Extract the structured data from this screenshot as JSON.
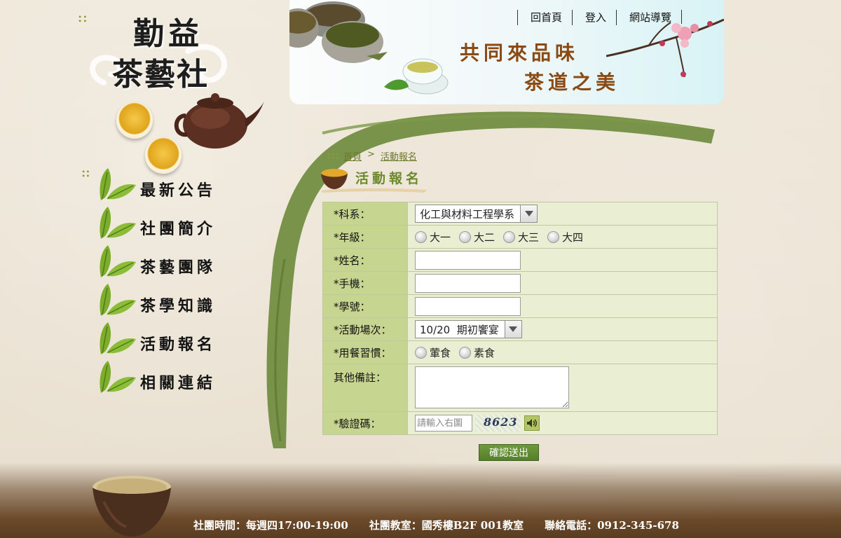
{
  "logo": {
    "line1": "勤益",
    "line2": "茶藝社"
  },
  "top_nav": [
    "回首頁",
    "登入",
    "網站導覽"
  ],
  "banner": {
    "slogan_line1": "共同來品味",
    "slogan_line2": "茶道之美"
  },
  "sidebar": {
    "items": [
      {
        "label": "最新公告"
      },
      {
        "label": "社團簡介"
      },
      {
        "label": "茶藝團隊"
      },
      {
        "label": "茶學知識"
      },
      {
        "label": "活動報名"
      },
      {
        "label": "相關連結"
      }
    ]
  },
  "breadcrumb": {
    "home": "首頁",
    "separator": ">",
    "current": "活動報名"
  },
  "page_title": "活動報名",
  "form": {
    "department": {
      "label": "*科系：",
      "selected": "化工與材料工程學系"
    },
    "grade": {
      "label": "*年級：",
      "options": [
        "大一",
        "大二",
        "大三",
        "大四"
      ]
    },
    "name": {
      "label": "*姓名：",
      "value": ""
    },
    "phone": {
      "label": "*手機：",
      "value": ""
    },
    "student_id": {
      "label": "*學號：",
      "value": ""
    },
    "session": {
      "label": "*活動場次：",
      "selected": "10/20  期初饗宴"
    },
    "diet": {
      "label": "*用餐習慣：",
      "options": [
        "葷食",
        "素食"
      ]
    },
    "notes": {
      "label": "其他備註：",
      "value": ""
    },
    "captcha": {
      "label": "*驗證碼：",
      "placeholder": "請輸入右圖",
      "image_text": "8623"
    },
    "submit_label": "確認送出"
  },
  "footer": {
    "hours": "社團時間：每週四17:00-19:00",
    "room": "社團教室：國秀樓B2F 001教室",
    "phone": "聯絡電話：0912-345-678"
  },
  "colors": {
    "accent_green": "#6d8a2c",
    "label_bg": "#c6d690",
    "value_bg": "#eaefd4",
    "footer_brown": "#6b4a2a"
  }
}
